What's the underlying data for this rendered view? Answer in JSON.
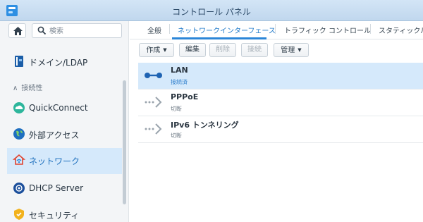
{
  "window": {
    "title": "コントロール パネル"
  },
  "sidebar": {
    "search_placeholder": "検索",
    "section": "接続性",
    "items": [
      {
        "label": "ドメイン/LDAP"
      },
      {
        "label": "QuickConnect"
      },
      {
        "label": "外部アクセス"
      },
      {
        "label": "ネットワーク"
      },
      {
        "label": "DHCP Server"
      },
      {
        "label": "セキュリティ"
      }
    ]
  },
  "tabs": [
    {
      "label": "全般"
    },
    {
      "label": "ネットワークインターフェース"
    },
    {
      "label": "トラフィック コントロール"
    },
    {
      "label": "スタティックル"
    }
  ],
  "toolbar": {
    "create": "作成",
    "edit": "編集",
    "delete": "削除",
    "connect": "接続",
    "manage": "管理"
  },
  "interfaces": [
    {
      "name": "LAN",
      "status": "接続済"
    },
    {
      "name": "PPPoE",
      "status": "切断"
    },
    {
      "name": "IPv6 トンネリング",
      "status": "切断"
    }
  ],
  "colors": {
    "accent": "#1f79c9",
    "selection": "#d5e9fb"
  }
}
